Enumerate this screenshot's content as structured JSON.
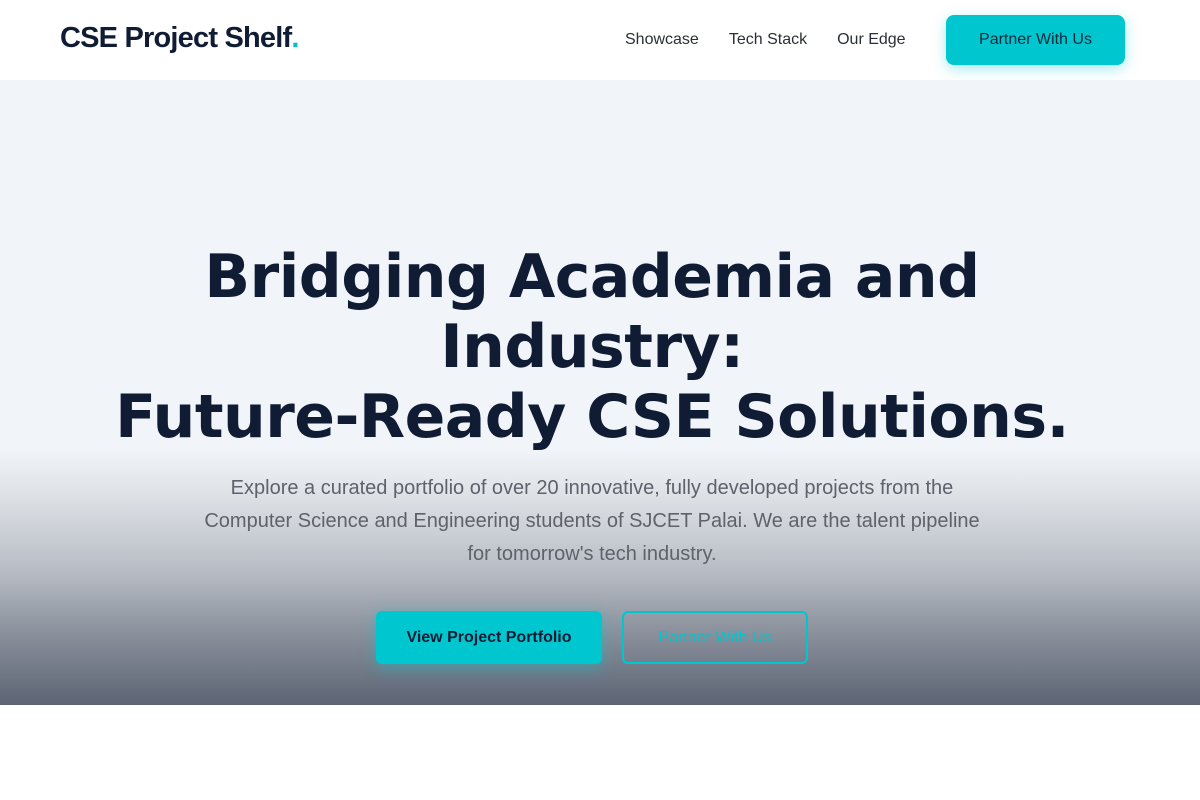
{
  "header": {
    "brand": "CSE Project Shelf",
    "brand_dot": ".",
    "nav": [
      {
        "label": "Showcase"
      },
      {
        "label": "Tech Stack"
      },
      {
        "label": "Our Edge"
      }
    ],
    "cta_label": "Partner With Us"
  },
  "hero": {
    "title_line1": "Bridging Academia and",
    "title_line2": "Industry:",
    "title_line3": "Future-Ready CSE Solutions.",
    "subtitle": "Explore a curated portfolio of over 20 innovative, fully developed projects from the Computer Science and Engineering students of SJCET Palai. We are the talent pipeline for tomorrow's tech industry.",
    "primary_button": "View Project Portfolio",
    "secondary_button": "Partner With Us"
  },
  "colors": {
    "accent": "#00c6cf",
    "heading": "#0f1c33",
    "body_text": "#5d626b",
    "hero_bg_top": "#f1f5f9",
    "hero_bg_bottom": "#5c6474"
  }
}
